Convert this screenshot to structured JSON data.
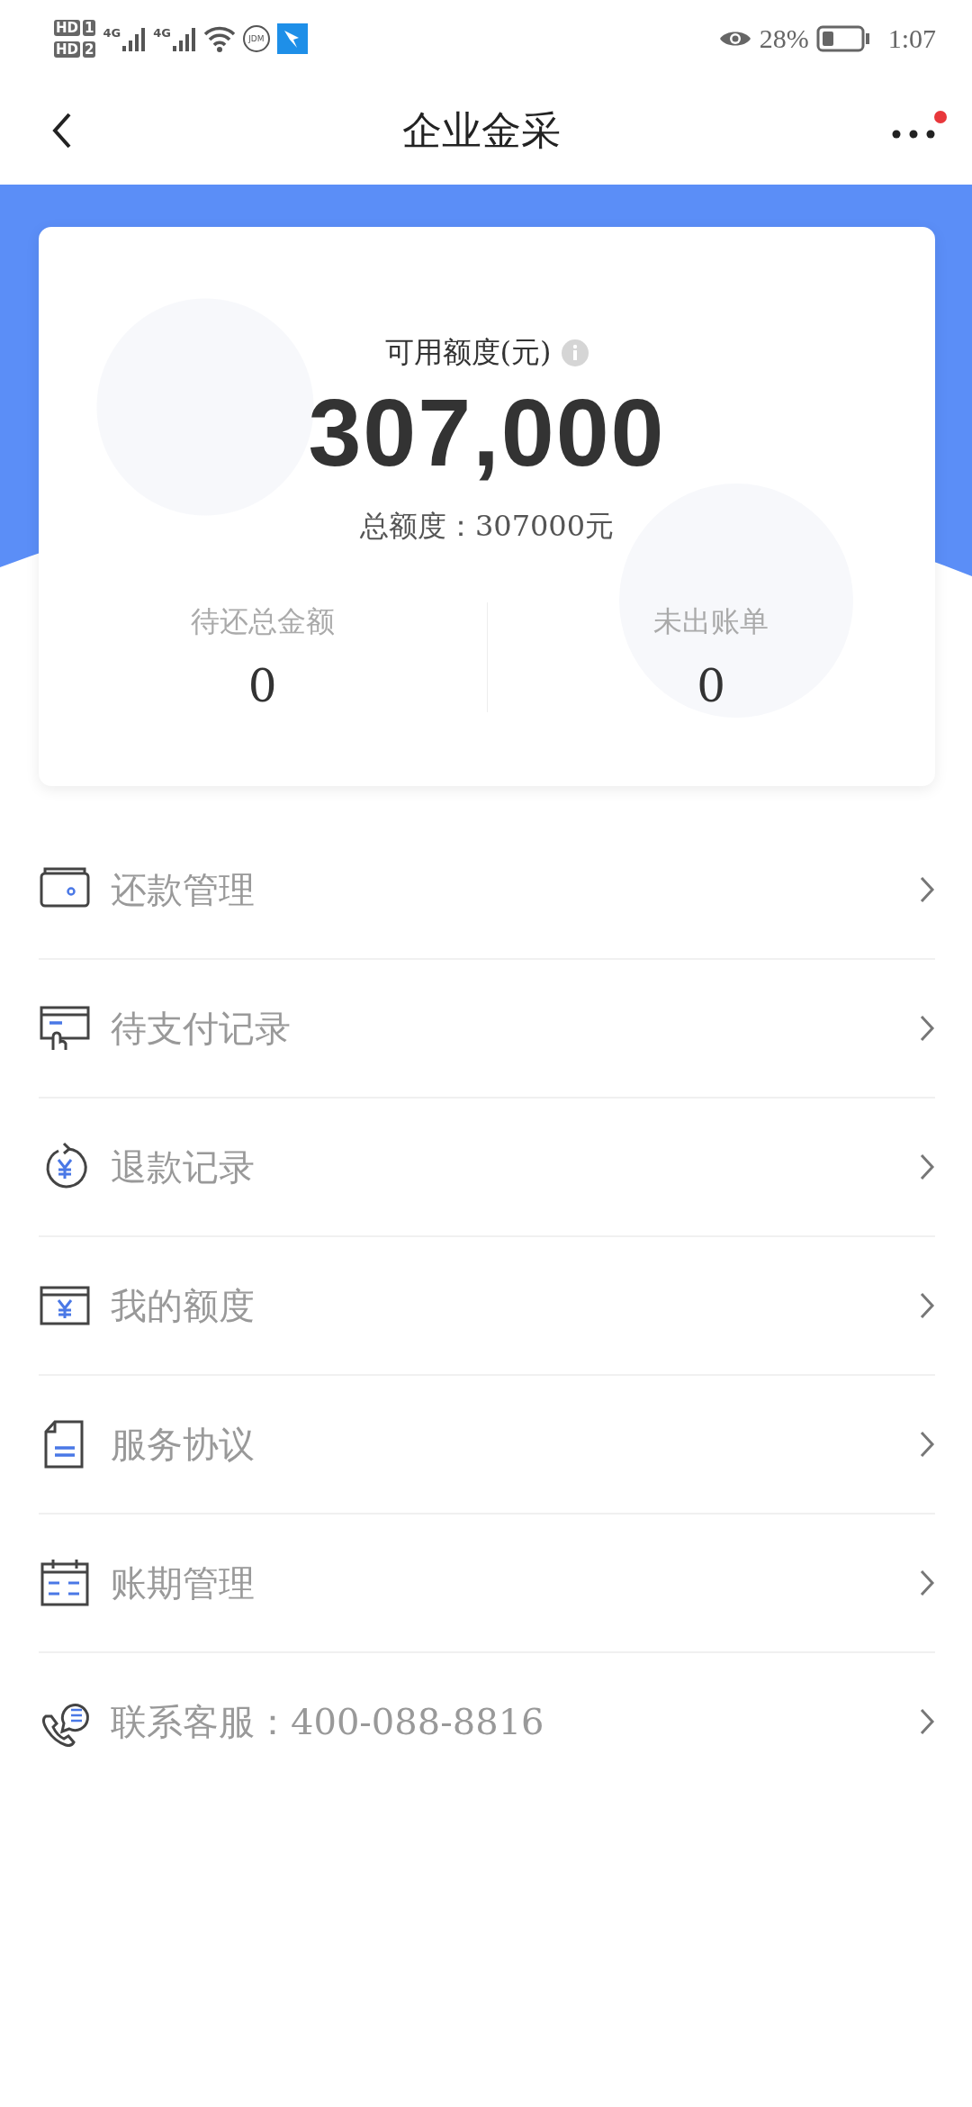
{
  "status_bar": {
    "sims": [
      {
        "hd": "HD",
        "slot": "1"
      },
      {
        "hd": "HD",
        "slot": "2"
      }
    ],
    "signals": [
      {
        "network": "4G"
      },
      {
        "network": "4G"
      }
    ],
    "app_badge": "JDM",
    "battery_level": "28%",
    "time": "1:07"
  },
  "header": {
    "title": "企业金采",
    "more_badge": true
  },
  "credit": {
    "available_label": "可用额度(元)",
    "available": "307,000",
    "total": "总额度：307000元",
    "stats": [
      {
        "label": "待还总金额",
        "value": "0"
      },
      {
        "label": "未出账单",
        "value": "0"
      }
    ]
  },
  "menu": [
    {
      "kind": "wallet",
      "label": "还款管理"
    },
    {
      "kind": "card-hand",
      "label": "待支付记录"
    },
    {
      "kind": "refund",
      "label": "退款记录"
    },
    {
      "kind": "quota",
      "label": "我的额度"
    },
    {
      "kind": "document",
      "label": "服务协议"
    },
    {
      "kind": "calendar",
      "label": "账期管理"
    },
    {
      "kind": "phone",
      "label": "联系客服：400-088-8816"
    }
  ]
}
